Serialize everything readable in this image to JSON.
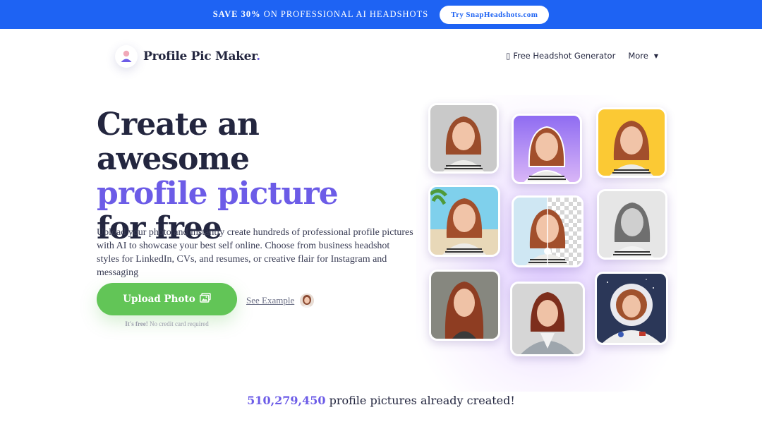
{
  "promo": {
    "bold": "SAVE 30%",
    "text": "ON PROFESSIONAL AI HEADSHOTS",
    "button": "Try SnapHeadshots.com"
  },
  "logo": {
    "name": "Profile Pic Maker",
    "dot": "."
  },
  "nav": {
    "generator": "Free Headshot Generator",
    "generator_icon_glyph": "▯",
    "more": "More",
    "more_caret": "▼"
  },
  "hero": {
    "line1": "Create an awesome",
    "line2": "profile picture",
    "line3": "for free",
    "description": "Upload your photo and instantly create hundreds of professional profile pictures with AI to showcase your best self online. Choose from business headshot styles for LinkedIn, CVs, and resumes, or creative flair for Instagram and messaging",
    "upload_label": "Upload Photo",
    "free_bold": "It's free!",
    "free_text": " No credit card required",
    "see_example": "See Example"
  },
  "counter": {
    "number": "510,279,450",
    "text": " profile pictures already created!"
  },
  "colors": {
    "brand": "#6c5ce7",
    "banner": "#1e63f3",
    "cta": "#62c557"
  }
}
